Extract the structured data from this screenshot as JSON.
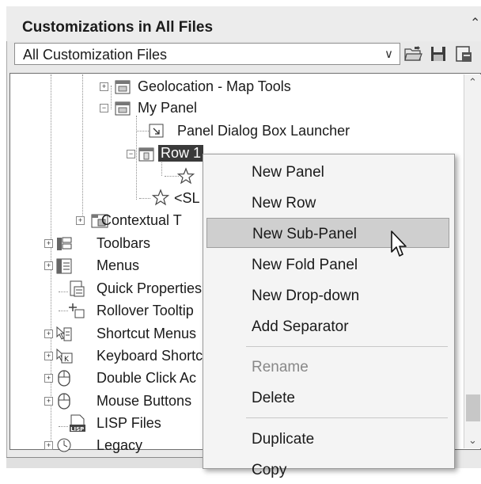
{
  "header": {
    "title": "Customizations in All Files",
    "collapse_glyph": "⌃"
  },
  "filter": {
    "value": "All Customization Files",
    "toolbar_icons": [
      "open-file-icon",
      "save-icon",
      "properties-icon"
    ]
  },
  "tree": {
    "items": [
      {
        "label": "Geolocation - Map Tools",
        "icon": "panel-icon",
        "expander": "+"
      },
      {
        "label": "My Panel",
        "icon": "panel-icon",
        "expander": "-"
      },
      {
        "label": "Panel Dialog Box Launcher",
        "icon": "launcher-icon"
      },
      {
        "label": "Row 1",
        "icon": "row-icon",
        "expander": "-",
        "selected": true
      },
      {
        "label": "",
        "icon": "star-icon"
      },
      {
        "label": "<SL",
        "icon": "star-icon"
      },
      {
        "label": "Contextual T",
        "icon": "contextual-tab-icon",
        "expander": "+"
      },
      {
        "label": "Toolbars",
        "icon": "toolbar-icon",
        "expander": "+"
      },
      {
        "label": "Menus",
        "icon": "menu-icon",
        "expander": "+"
      },
      {
        "label": "Quick Properties",
        "icon": "quick-properties-icon"
      },
      {
        "label": "Rollover Tooltip",
        "icon": "rollover-tooltip-icon"
      },
      {
        "label": "Shortcut Menus",
        "icon": "shortcut-menu-icon",
        "expander": "+"
      },
      {
        "label": "Keyboard Shortc",
        "icon": "keyboard-icon",
        "expander": "+"
      },
      {
        "label": "Double Click Ac",
        "icon": "mouse-icon",
        "expander": "+"
      },
      {
        "label": "Mouse Buttons",
        "icon": "mouse-icon",
        "expander": "+"
      },
      {
        "label": "LISP Files",
        "icon": "lisp-icon"
      },
      {
        "label": "Legacy",
        "icon": "legacy-icon",
        "expander": "+"
      }
    ]
  },
  "context_menu": {
    "items": [
      {
        "label": "New Panel"
      },
      {
        "label": "New Row"
      },
      {
        "label": "New Sub-Panel",
        "hover": true
      },
      {
        "label": "New Fold Panel"
      },
      {
        "label": "New Drop-down"
      },
      {
        "label": "Add Separator"
      },
      {
        "label": "Rename",
        "disabled": true
      },
      {
        "label": "Delete"
      },
      {
        "label": "Duplicate"
      },
      {
        "label": "Copy"
      }
    ]
  }
}
